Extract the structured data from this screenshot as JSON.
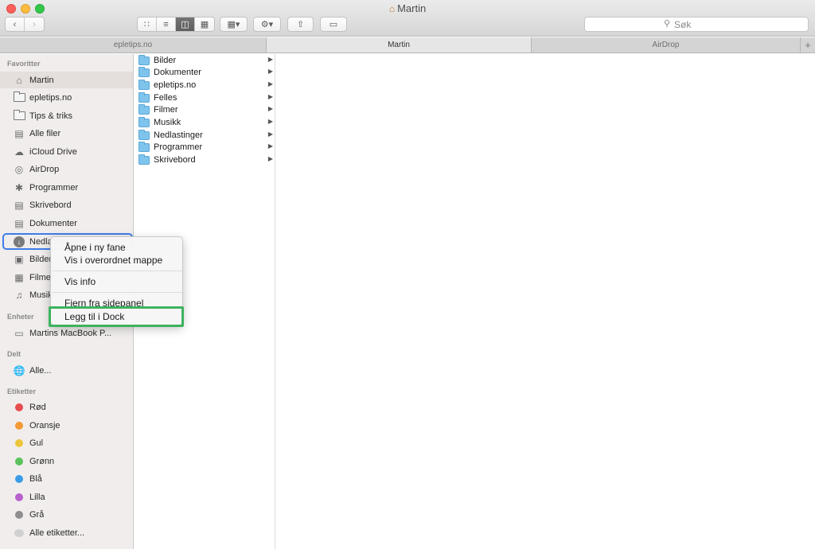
{
  "window": {
    "title": "Martin"
  },
  "search": {
    "placeholder": "Søk"
  },
  "tabs": [
    "epletips.no",
    "Martin",
    "AirDrop"
  ],
  "sidebar": {
    "favorites_header": "Favoritter",
    "favorites": [
      {
        "label": "Martin",
        "icon": "home-icon"
      },
      {
        "label": "epletips.no",
        "icon": "folder-icon"
      },
      {
        "label": "Tips & triks",
        "icon": "folder-icon"
      },
      {
        "label": "Alle filer",
        "icon": "all-files-icon"
      },
      {
        "label": "iCloud Drive",
        "icon": "cloud-icon"
      },
      {
        "label": "AirDrop",
        "icon": "airdrop-icon"
      },
      {
        "label": "Programmer",
        "icon": "applications-icon"
      },
      {
        "label": "Skrivebord",
        "icon": "desktop-icon"
      },
      {
        "label": "Dokumenter",
        "icon": "documents-icon"
      },
      {
        "label": "Nedlastinger",
        "icon": "downloads-icon"
      },
      {
        "label": "Bilder",
        "icon": "camera-icon"
      },
      {
        "label": "Filmer",
        "icon": "film-icon"
      },
      {
        "label": "Musikk",
        "icon": "music-icon"
      }
    ],
    "devices_header": "Enheter",
    "devices": [
      {
        "label": "Martins MacBook P...",
        "icon": "laptop-icon"
      }
    ],
    "shared_header": "Delt",
    "shared": [
      {
        "label": "Alle...",
        "icon": "network-icon"
      }
    ],
    "tags_header": "Etiketter",
    "tags": [
      {
        "label": "Rød",
        "color": "#e84c4c"
      },
      {
        "label": "Oransje",
        "color": "#f39a33"
      },
      {
        "label": "Gul",
        "color": "#ecc53a"
      },
      {
        "label": "Grønn",
        "color": "#5ac25a"
      },
      {
        "label": "Blå",
        "color": "#3a9be8"
      },
      {
        "label": "Lilla",
        "color": "#b661cc"
      },
      {
        "label": "Grå",
        "color": "#8e8e8e"
      },
      {
        "label": "Alle etiketter...",
        "color": "#d0d0d0"
      }
    ]
  },
  "column": {
    "items": [
      "Bilder",
      "Dokumenter",
      "epletips.no",
      "Felles",
      "Filmer",
      "Musikk",
      "Nedlastinger",
      "Programmer",
      "Skrivebord"
    ]
  },
  "context_menu": {
    "items": [
      "Åpne i ny fane",
      "Vis i overordnet mappe",
      "Vis info",
      "Fjern fra sidepanel",
      "Legg til i Dock"
    ],
    "highlighted": "Legg til i Dock"
  }
}
